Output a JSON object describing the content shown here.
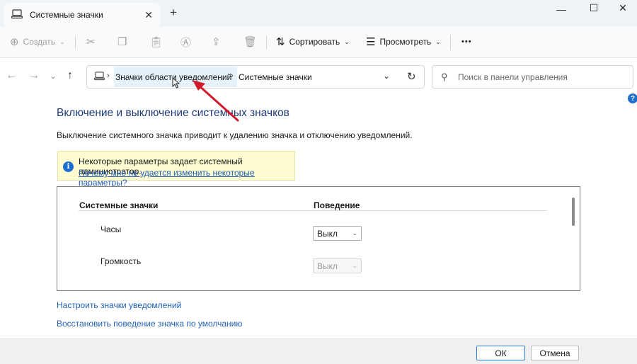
{
  "window": {
    "tab_title": "Системные значки",
    "tab_icon": "computer-icon"
  },
  "toolbar": {
    "create_label": "Создать",
    "sort_label": "Сортировать",
    "view_label": "Просмотреть",
    "more_label": "•••"
  },
  "address": {
    "crumb1": "Значки области уведомлений",
    "crumb2": "Системные значки"
  },
  "search": {
    "placeholder": "Поиск в панели управления"
  },
  "main": {
    "heading": "Включение и выключение системных значков",
    "description": "Выключение системного значка приводит к удалению значка и отключению уведомлений.",
    "info_text": "Некоторые параметры задает системный администратор.",
    "info_link": "Почему мне не удается изменить некоторые параметры?",
    "col_icons": "Системные значки",
    "col_behavior": "Поведение",
    "rows": [
      {
        "label": "Часы",
        "value": "Выкл",
        "enabled": true
      },
      {
        "label": "Громкость",
        "value": "Выкл",
        "enabled": false
      }
    ],
    "link_customize": "Настроить значки уведомлений",
    "link_restore": "Восстановить поведение значка по умолчанию"
  },
  "footer": {
    "ok_label": "ОК",
    "cancel_label": "Отмена"
  },
  "colors": {
    "accent": "#1f6fd0",
    "link": "#1f5fb8",
    "heading": "#1e3a78",
    "annotation_arrow": "#d0192b"
  }
}
